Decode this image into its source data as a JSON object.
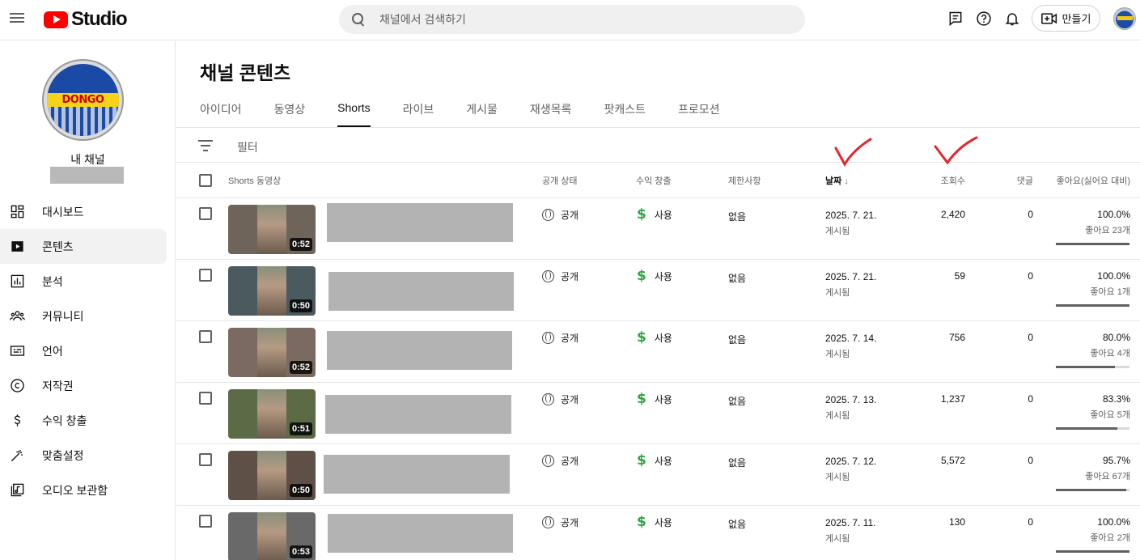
{
  "app": {
    "logo_text": "Studio"
  },
  "search": {
    "placeholder": "채널에서 검색하기"
  },
  "header": {
    "create_label": "만들기"
  },
  "sidebar": {
    "channel_name": "내 채널",
    "avatar_text": "DONGO",
    "items": [
      {
        "label": "대시보드",
        "icon": "dashboard-icon",
        "active": false
      },
      {
        "label": "콘텐츠",
        "icon": "content-icon",
        "active": true
      },
      {
        "label": "분석",
        "icon": "analytics-icon",
        "active": false
      },
      {
        "label": "커뮤니티",
        "icon": "community-icon",
        "active": false
      },
      {
        "label": "언어",
        "icon": "subtitles-icon",
        "active": false
      },
      {
        "label": "저작권",
        "icon": "copyright-icon",
        "active": false
      },
      {
        "label": "수익 창출",
        "icon": "dollar-icon",
        "active": false
      },
      {
        "label": "맞춤설정",
        "icon": "magic-wand-icon",
        "active": false
      },
      {
        "label": "오디오 보관함",
        "icon": "audio-library-icon",
        "active": false
      }
    ]
  },
  "main": {
    "title": "채널 콘텐츠",
    "tabs": [
      {
        "label": "아이디어",
        "active": false
      },
      {
        "label": "동영상",
        "active": false
      },
      {
        "label": "Shorts",
        "active": true
      },
      {
        "label": "라이브",
        "active": false
      },
      {
        "label": "게시물",
        "active": false
      },
      {
        "label": "재생목록",
        "active": false
      },
      {
        "label": "팟캐스트",
        "active": false
      },
      {
        "label": "프로모션",
        "active": false
      }
    ],
    "filter_label": "필터",
    "columns": {
      "video": "Shorts 동영상",
      "visibility": "공개 상태",
      "monetization": "수익 창출",
      "restrictions": "제한사항",
      "date": "날짜",
      "views": "조회수",
      "comments": "댓글",
      "likes": "좋아요(싫어요 대비)"
    },
    "rows": [
      {
        "duration": "0:52",
        "visibility": "공개",
        "monetization": "사용",
        "restrictions": "없음",
        "date": "2025. 7. 21.",
        "date_status": "게시됨",
        "views": "2,420",
        "comments": "0",
        "likes_pct": "100.0%",
        "likes_count": "좋아요 23개",
        "like_ratio": 1.0,
        "thumb_color": "#6e6459"
      },
      {
        "duration": "0:50",
        "visibility": "공개",
        "monetization": "사용",
        "restrictions": "없음",
        "date": "2025. 7. 21.",
        "date_status": "게시됨",
        "views": "59",
        "comments": "0",
        "likes_pct": "100.0%",
        "likes_count": "좋아요 1개",
        "like_ratio": 1.0,
        "thumb_color": "#4b5a5e"
      },
      {
        "duration": "0:52",
        "visibility": "공개",
        "monetization": "사용",
        "restrictions": "없음",
        "date": "2025. 7. 14.",
        "date_status": "게시됨",
        "views": "756",
        "comments": "0",
        "likes_pct": "80.0%",
        "likes_count": "좋아요 4개",
        "like_ratio": 0.8,
        "thumb_color": "#7a6a62"
      },
      {
        "duration": "0:51",
        "visibility": "공개",
        "monetization": "사용",
        "restrictions": "없음",
        "date": "2025. 7. 13.",
        "date_status": "게시됨",
        "views": "1,237",
        "comments": "0",
        "likes_pct": "83.3%",
        "likes_count": "좋아요 5개",
        "like_ratio": 0.833,
        "thumb_color": "#5a6b45"
      },
      {
        "duration": "0:50",
        "visibility": "공개",
        "monetization": "사용",
        "restrictions": "없음",
        "date": "2025. 7. 12.",
        "date_status": "게시됨",
        "views": "5,572",
        "comments": "0",
        "likes_pct": "95.7%",
        "likes_count": "좋아요 67개",
        "like_ratio": 0.957,
        "thumb_color": "#5e4f47"
      },
      {
        "duration": "0:53",
        "visibility": "공개",
        "monetization": "사용",
        "restrictions": "없음",
        "date": "2025. 7. 11.",
        "date_status": "게시됨",
        "views": "130",
        "comments": "0",
        "likes_pct": "100.0%",
        "likes_count": "좋아요 2개",
        "like_ratio": 1.0,
        "thumb_color": "#696969"
      }
    ]
  },
  "colors": {
    "brand": "#ff0000",
    "money": "#2ba640",
    "annotation": "#e8242c"
  }
}
